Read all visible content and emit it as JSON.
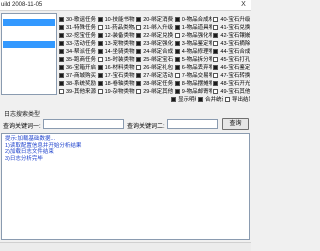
{
  "window": {
    "title": "uild 2008-11-05",
    "close": "X"
  },
  "colors": {
    "selection": "#3399ff",
    "log_text": "#1a3fcc",
    "check": "#1a1a1a"
  },
  "left_list": {
    "items": [
      {
        "selected": true
      },
      {
        "selected": false
      },
      {
        "selected": true
      }
    ]
  },
  "item_types": {
    "columns": [
      [
        {
          "label": "30-歌谣任务物品",
          "checked": true
        },
        {
          "label": "31-特殊任务物品",
          "checked": true
        },
        {
          "label": "32-挖宝任务物品",
          "checked": true
        },
        {
          "label": "33-活动任务物品",
          "checked": true
        },
        {
          "label": "34-帮派任务物品",
          "checked": true
        },
        {
          "label": "35-跑商任务物品",
          "checked": true
        },
        {
          "label": "36-宝箱开启物品",
          "checked": true
        },
        {
          "label": "37-商城购买物品",
          "checked": true
        },
        {
          "label": "38-系统奖励物品",
          "checked": true
        },
        {
          "label": "39-其他来源物品",
          "checked": false
        }
      ],
      [
        {
          "label": "10-技能书物品",
          "checked": true
        },
        {
          "label": "11-药品类物品",
          "checked": false
        },
        {
          "label": "12-装备类物品",
          "checked": true
        },
        {
          "label": "13-宠物类物品",
          "checked": true
        },
        {
          "label": "14-坐骑类物品",
          "checked": true
        },
        {
          "label": "15-时装类物品",
          "checked": false
        },
        {
          "label": "16-材料类物品",
          "checked": true
        },
        {
          "label": "17-宝石类物品",
          "checked": true
        },
        {
          "label": "18-卷轴类物品",
          "checked": true
        },
        {
          "label": "19-杂物类物品",
          "checked": false
        }
      ],
      [
        {
          "label": "20-绑定消费物品",
          "checked": true
        },
        {
          "label": "21-绑入升级材料",
          "checked": false
        },
        {
          "label": "22-绑定兑换物品",
          "checked": true
        },
        {
          "label": "23-绑定强化物品",
          "checked": true
        },
        {
          "label": "24-绑定合成物品",
          "checked": true
        },
        {
          "label": "25-绑定宝石物品",
          "checked": true
        },
        {
          "label": "26-绑定礼包物品",
          "checked": false
        },
        {
          "label": "27-绑定活动物品",
          "checked": true
        },
        {
          "label": "28-绑定任务物品",
          "checked": true
        },
        {
          "label": "29-绑定其他物品",
          "checked": false
        }
      ],
      [
        {
          "label": "0-物品合成材料",
          "checked": true
        },
        {
          "label": "1-物品道具物品",
          "checked": true
        },
        {
          "label": "2-物品强化物品",
          "checked": false
        },
        {
          "label": "3-物品鉴定物品",
          "checked": true
        },
        {
          "label": "4-物品修理物品",
          "checked": true
        },
        {
          "label": "5-物品拆分物品",
          "checked": true
        },
        {
          "label": "6-物品丢弃物品",
          "checked": true
        },
        {
          "label": "7-物品交易物品",
          "checked": false
        },
        {
          "label": "8-物品摆摊物品",
          "checked": true
        },
        {
          "label": "9-物品邮寄物品",
          "checked": true
        }
      ],
      [
        {
          "label": "40-宝石升级材料",
          "checked": false
        },
        {
          "label": "41-宝石兑换物品",
          "checked": false
        },
        {
          "label": "42-宝石镶嵌物品",
          "checked": true
        },
        {
          "label": "43-宝石摘除物品",
          "checked": false
        },
        {
          "label": "44-宝石合成物品",
          "checked": true
        },
        {
          "label": "45-宝石打孔物品",
          "checked": false
        },
        {
          "label": "46-宝石鉴定物品",
          "checked": true
        },
        {
          "label": "47-宝石转换物品",
          "checked": false
        },
        {
          "label": "48-宝石开光物品",
          "checked": true
        },
        {
          "label": "49-宝石其他物品",
          "checked": false
        }
      ]
    ]
  },
  "options": [
    {
      "label": "显示明细",
      "checked": true
    },
    {
      "label": "合并统计",
      "checked": true
    },
    {
      "label": "导出结果",
      "checked": false
    }
  ],
  "search": {
    "type_label": "日志搜索类型",
    "keyword1_label": "查询关键词一:",
    "keyword1_value": "",
    "keyword2_label": "查询关键词二:",
    "keyword2_value": "",
    "button": "查询"
  },
  "log": {
    "lines": [
      "提示:加载基础数据...",
      "1)读取配置信息并开始分析结果",
      "2)加载日志文件结束",
      "3)日志分析完毕"
    ]
  }
}
